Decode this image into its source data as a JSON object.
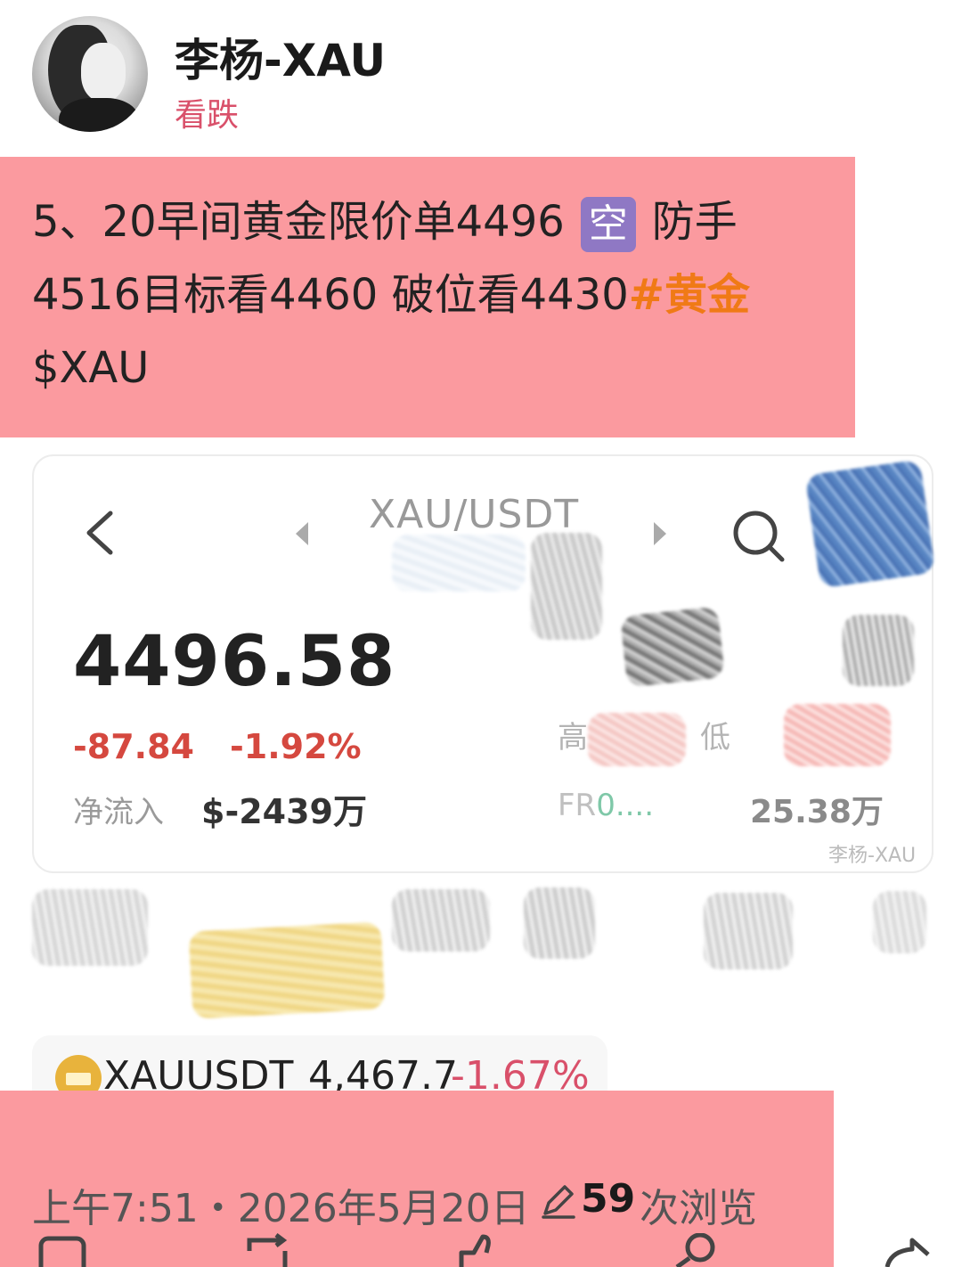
{
  "author": {
    "name": "李杨-XAU",
    "sentiment": "看跌",
    "avatar_icon": "ink-portrait-avatar"
  },
  "post": {
    "line1_prefix": "5、20早间黄金限价单4496",
    "short_badge": "空",
    "line1_suffix": "防手",
    "line2_text": "4516目标看4460  破位看4430",
    "hashtag": "#黄金",
    "line3_text": "$XAU",
    "highlight_color": "#fb9a9f"
  },
  "card": {
    "pair": "XAU/USDT",
    "price": "4496.58",
    "change_abs": "-87.84",
    "change_pct": "-1.92%",
    "netflow_label": "净流入",
    "netflow_value": "$-2439万",
    "high_label": "高",
    "low_label": "低",
    "fr_label": "FR",
    "fr_value": "0....",
    "volume_value": "25.38万",
    "watermark": "李杨-XAU",
    "down_color": "#d5483f"
  },
  "ticker": {
    "symbol": "XAUUSDT",
    "price": "4,467.7",
    "change": "-1.67%",
    "coin_icon": "gold-bars-icon"
  },
  "meta": {
    "time": "上午7:51・2026年5月20日",
    "views_count": "59",
    "views_label": "次浏览"
  },
  "actions": [
    "comment-icon",
    "repost-icon",
    "like-icon",
    "tip-icon",
    "share-icon"
  ]
}
